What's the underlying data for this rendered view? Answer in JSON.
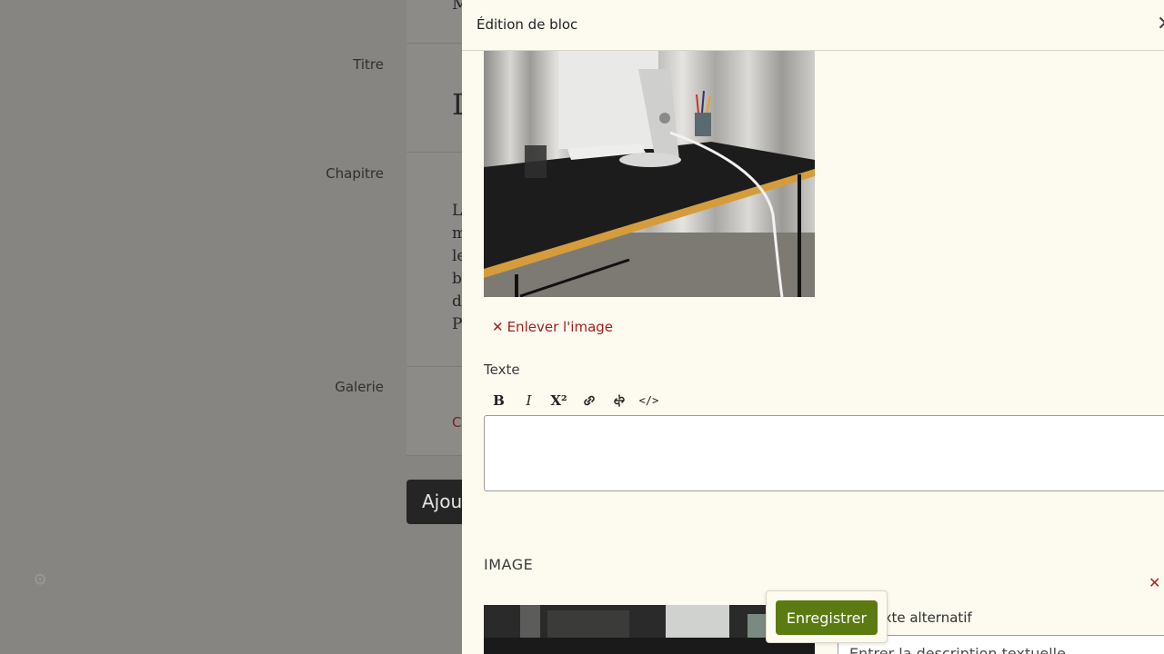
{
  "background": {
    "labels": {
      "titre": "Titre",
      "chapitre": "Chapitre",
      "galerie": "Galerie"
    },
    "fragments": {
      "top": "M",
      "title_initial": "L",
      "chapter_lines": [
        "L",
        "m",
        "le",
        "b",
        "d",
        "P"
      ],
      "galerie_link": "C"
    },
    "add_button_label": "Ajou"
  },
  "drawer": {
    "title": "Édition de bloc",
    "close_symbol": "✕",
    "remove_image_label": "Enlever l'image",
    "remove_symbol": "✕",
    "text_field_label": "Texte",
    "toolbar": {
      "bold": "B",
      "italic": "I",
      "superscript": "X²",
      "link": "🔗",
      "unlink": "⊘",
      "code": "</>"
    },
    "section_title": "IMAGE",
    "section_remove_symbol": "✕",
    "alt_label": "Texte alternatif",
    "alt_placeholder": "Entrer la description textuelle",
    "save_label": "Enregistrer"
  },
  "colors": {
    "drawer_bg": "#fdfbef",
    "save_button": "#5b7a12",
    "remove_red": "#a51d1d",
    "overlay": "#878581"
  }
}
